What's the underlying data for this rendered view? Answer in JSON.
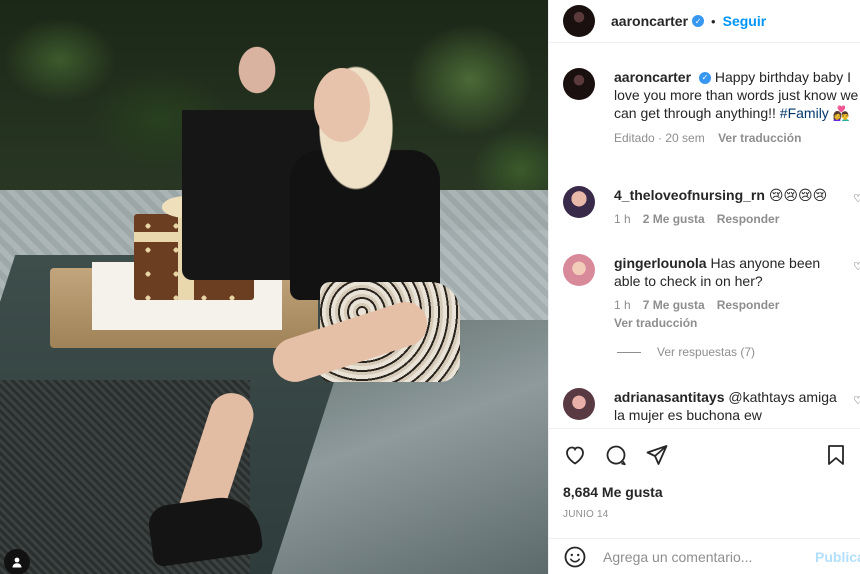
{
  "post": {
    "username": "aaroncarter",
    "follow_label": "Seguir",
    "separator": "•",
    "caption": {
      "username": "aaroncarter",
      "text": "Happy birthday baby I love you more than words just know we can get through anything!!",
      "hashtag": "#Family",
      "emoji": "👩‍❤️‍👨",
      "meta_time": "Editado · 20 sem",
      "translate": "Ver traducción"
    },
    "comments": [
      {
        "username": "4_theloveofnursing_rn",
        "text": "😢😢😢😢",
        "time": "1 h",
        "likes": "2 Me gusta",
        "reply": "Responder",
        "avatar_color": "#3a2a4a"
      },
      {
        "username": "gingerlounola",
        "text": "Has anyone been able to check in on her?",
        "time": "1 h",
        "likes": "7 Me gusta",
        "reply": "Responder",
        "translate": "Ver traducción",
        "avatar_color": "#d88a9a"
      },
      {
        "username": "adrianasantitays",
        "text": "@kathtays amiga la mujer es buchona ew",
        "avatar_color": "#5a3a42"
      }
    ],
    "view_replies": "Ver respuestas (7)",
    "likes_count": "8,684 Me gusta",
    "date": "JUNIO 14",
    "comment_placeholder": "Agrega un comentario...",
    "publish_label": "Publicar"
  },
  "icons": {
    "verified": "verified-badge-icon",
    "heart": "heart-icon",
    "comment": "comment-icon",
    "share": "share-icon",
    "bookmark": "bookmark-icon",
    "emoji": "emoji-icon",
    "user_tag": "user-tag-icon"
  },
  "colors": {
    "accent": "#0095f6",
    "verified": "#3897f0",
    "hashtag": "#00376b",
    "muted": "#8e8e8e"
  }
}
